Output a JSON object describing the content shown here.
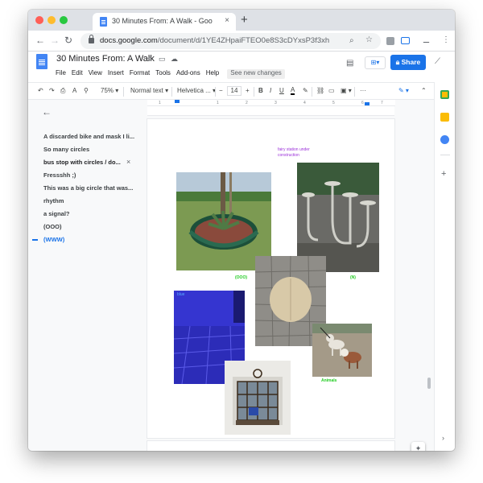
{
  "browser": {
    "tab_title": "30 Minutes From: A Walk - Goo",
    "tab_close": "×",
    "new_tab": "+",
    "url_host": "docs.google.com",
    "url_path": "/document/d/1YE4ZHpaiFTEO0e8S3cDYxsP3f3xhW5..."
  },
  "doc": {
    "title": "30 Minutes From: A Walk",
    "menus": [
      "File",
      "Edit",
      "View",
      "Insert",
      "Format",
      "Tools",
      "Add-ons",
      "Help"
    ],
    "see_changes": "See new changes",
    "share_label": "Share"
  },
  "format_toolbar": {
    "zoom": "75%",
    "style": "Normal text",
    "font": "Helvetica ...",
    "font_size": "14"
  },
  "outline": {
    "items": [
      "A discarded bike and mask I li...",
      "So many circles",
      "bus stop with circles / do...",
      "Fressshh ;)",
      "This was a big circle that was...",
      "rhythm",
      "a signal?",
      "(OOO)",
      "(WWW)"
    ],
    "close_symbol": "×"
  },
  "ruler_ticks": [
    "1",
    "1",
    "2",
    "3",
    "4",
    "5",
    "6",
    "7"
  ],
  "page": {
    "note_line1": "fairy station under",
    "note_line2": "construction",
    "captions": {
      "ooo": "(OOO)",
      "n": "(N)",
      "blue": "blue",
      "animals": "Animals"
    }
  },
  "colors": {
    "accent": "#1a73e8",
    "note": "#9b30d9",
    "caption_green": "#22cc22",
    "blue_caption": "#55aaff"
  }
}
